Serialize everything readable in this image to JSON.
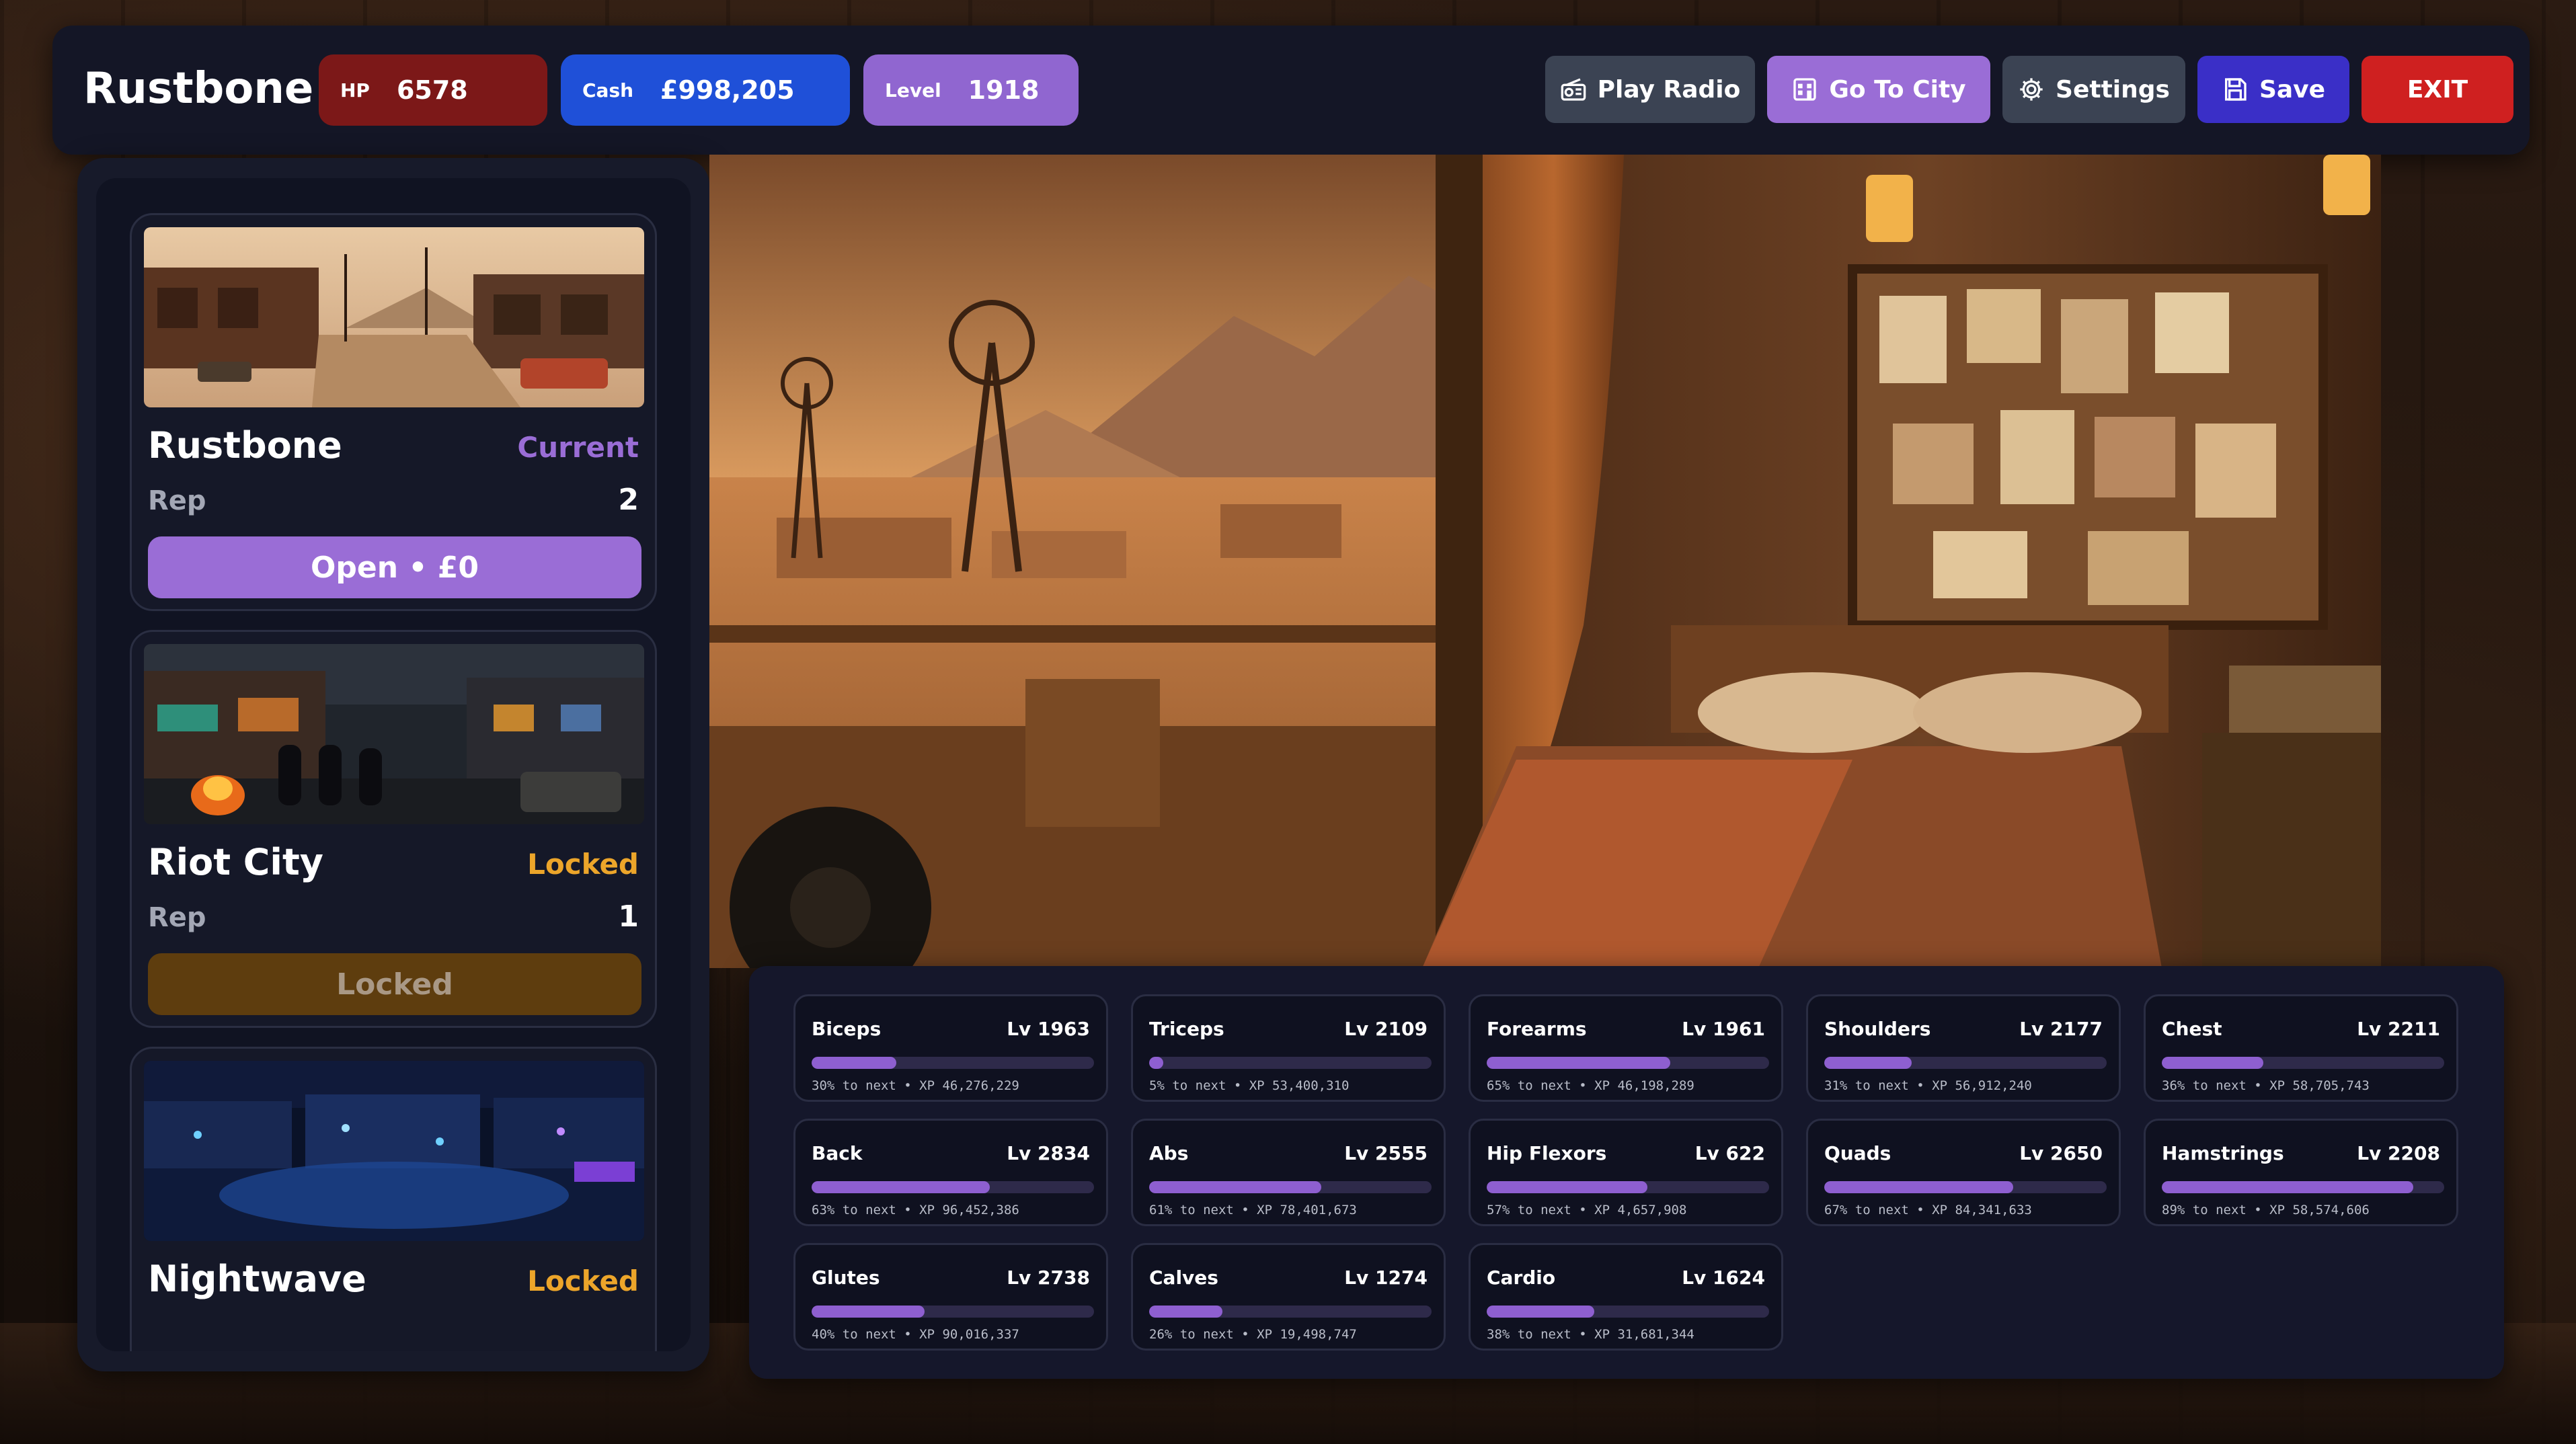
{
  "header": {
    "title": "Rustbone",
    "hp": {
      "label": "HP",
      "value": "6578"
    },
    "cash": {
      "label": "Cash",
      "value": "£998,205"
    },
    "level": {
      "label": "Level",
      "value": "1918"
    },
    "buttons": {
      "radio": "Play Radio",
      "city": "Go To City",
      "settings": "Settings",
      "save": "Save",
      "exit": "EXIT"
    }
  },
  "cities": [
    {
      "name": "Rustbone",
      "status": "Current",
      "rep_label": "Rep",
      "rep": "2",
      "button": "Open • £0"
    },
    {
      "name": "Riot City",
      "status": "Locked",
      "rep_label": "Rep",
      "rep": "1",
      "button": "Locked"
    },
    {
      "name": "Nightwave",
      "status": "Locked"
    }
  ],
  "stats": [
    {
      "name": "Biceps",
      "level": "Lv 1963",
      "progress": 0.3,
      "sub": "30% to next • XP 46,276,229"
    },
    {
      "name": "Triceps",
      "level": "Lv 2109",
      "progress": 0.05,
      "sub": "5% to next • XP 53,400,310"
    },
    {
      "name": "Forearms",
      "level": "Lv 1961",
      "progress": 0.65,
      "sub": "65% to next • XP 46,198,289"
    },
    {
      "name": "Shoulders",
      "level": "Lv 2177",
      "progress": 0.31,
      "sub": "31% to next • XP 56,912,240"
    },
    {
      "name": "Chest",
      "level": "Lv 2211",
      "progress": 0.36,
      "sub": "36% to next • XP 58,705,743"
    },
    {
      "name": "Back",
      "level": "Lv 2834",
      "progress": 0.63,
      "sub": "63% to next • XP 96,452,386"
    },
    {
      "name": "Abs",
      "level": "Lv 2555",
      "progress": 0.61,
      "sub": "61% to next • XP 78,401,673"
    },
    {
      "name": "Hip Flexors",
      "level": "Lv 622",
      "progress": 0.57,
      "sub": "57% to next • XP 4,657,908"
    },
    {
      "name": "Quads",
      "level": "Lv 2650",
      "progress": 0.67,
      "sub": "67% to next • XP 84,341,633"
    },
    {
      "name": "Hamstrings",
      "level": "Lv 2208",
      "progress": 0.89,
      "sub": "89% to next • XP 58,574,606"
    },
    {
      "name": "Glutes",
      "level": "Lv 2738",
      "progress": 0.4,
      "sub": "40% to next • XP 90,016,337"
    },
    {
      "name": "Calves",
      "level": "Lv 1274",
      "progress": 0.26,
      "sub": "26% to next • XP 19,498,747"
    },
    {
      "name": "Cardio",
      "level": "Lv 1624",
      "progress": 0.38,
      "sub": "38% to next • XP 31,681,344"
    }
  ],
  "icons": {
    "radio": "radio-icon",
    "city": "city-icon",
    "settings": "gear-icon",
    "save": "floppy-disk-icon"
  },
  "colors": {
    "accent_purple": "#9a6dd6",
    "hp_red": "#7c1818",
    "cash_blue": "#1f50d8",
    "save_blue": "#3a2fc7",
    "exit_red": "#cf2020",
    "locked_orange": "#eca52a"
  }
}
